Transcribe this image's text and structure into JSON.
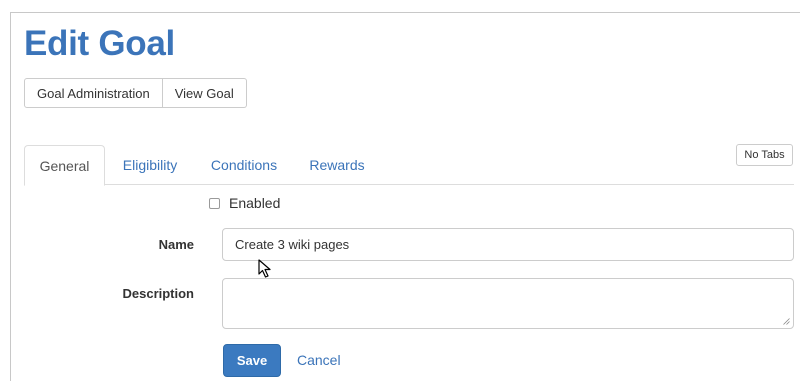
{
  "page": {
    "title": "Edit Goal"
  },
  "top_buttons": {
    "goal_administration": "Goal Administration",
    "view_goal": "View Goal"
  },
  "tabs": [
    {
      "label": "General",
      "active": true
    },
    {
      "label": "Eligibility",
      "active": false
    },
    {
      "label": "Conditions",
      "active": false
    },
    {
      "label": "Rewards",
      "active": false
    }
  ],
  "no_tabs_label": "No Tabs",
  "form": {
    "enabled_label": "Enabled",
    "enabled_checked": false,
    "name_label": "Name",
    "name_value": "Create 3 wiki pages",
    "description_label": "Description",
    "description_value": "",
    "save_label": "Save",
    "cancel_label": "Cancel"
  },
  "colors": {
    "accent": "#3b74b9",
    "primary_button": "#3b7ac0",
    "border": "#cccccc"
  },
  "icons": {
    "cursor": "mouse-pointer-icon",
    "resize": "resize-grip-icon"
  }
}
